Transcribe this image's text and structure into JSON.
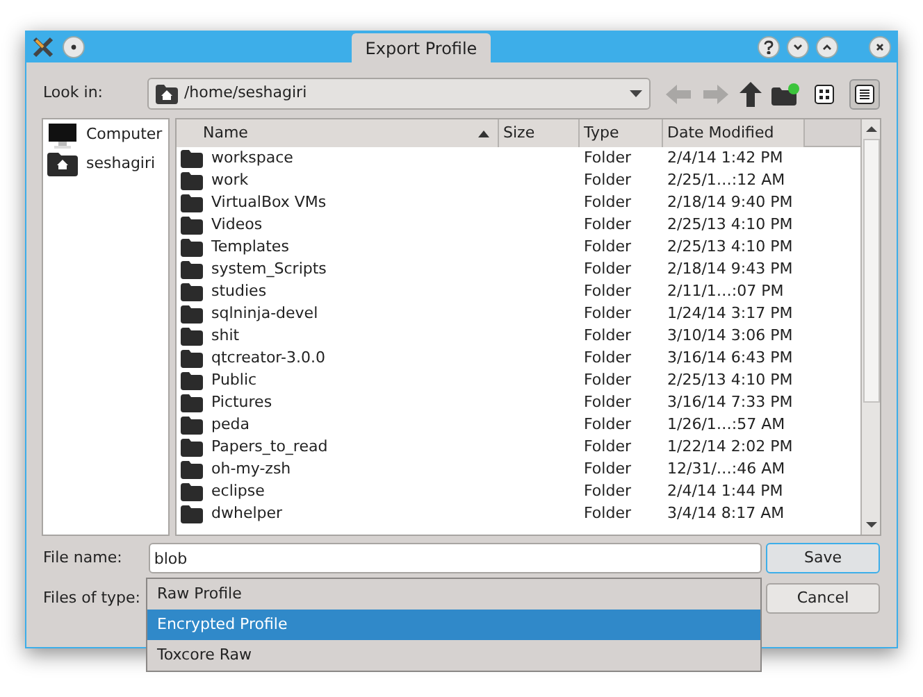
{
  "window": {
    "title": "Export Profile"
  },
  "look_in": {
    "label": "Look in:",
    "path": "/home/seshagiri"
  },
  "sidebar": {
    "items": [
      {
        "label": "Computer",
        "kind": "computer"
      },
      {
        "label": "seshagiri",
        "kind": "home"
      }
    ]
  },
  "table": {
    "columns": [
      {
        "label": "Name",
        "sorted": true
      },
      {
        "label": "Size",
        "sorted": false
      },
      {
        "label": "Type",
        "sorted": false
      },
      {
        "label": "Date Modified",
        "sorted": false
      }
    ],
    "rows": [
      [
        "workspace",
        "",
        "Folder",
        "2/4/14 1:42 PM"
      ],
      [
        "work",
        "",
        "Folder",
        "2/25/1…:12 AM"
      ],
      [
        "VirtualBox VMs",
        "",
        "Folder",
        "2/18/14 9:40 PM"
      ],
      [
        "Videos",
        "",
        "Folder",
        "2/25/13 4:10 PM"
      ],
      [
        "Templates",
        "",
        "Folder",
        "2/25/13 4:10 PM"
      ],
      [
        "system_Scripts",
        "",
        "Folder",
        "2/18/14 9:43 PM"
      ],
      [
        "studies",
        "",
        "Folder",
        "2/11/1…:07 PM"
      ],
      [
        "sqlninja-devel",
        "",
        "Folder",
        "1/24/14 3:17 PM"
      ],
      [
        "shit",
        "",
        "Folder",
        "3/10/14 3:06 PM"
      ],
      [
        "qtcreator-3.0.0",
        "",
        "Folder",
        "3/16/14 6:43 PM"
      ],
      [
        "Public",
        "",
        "Folder",
        "2/25/13 4:10 PM"
      ],
      [
        "Pictures",
        "",
        "Folder",
        "3/16/14 7:33 PM"
      ],
      [
        "peda",
        "",
        "Folder",
        "1/26/1…:57 AM"
      ],
      [
        "Papers_to_read",
        "",
        "Folder",
        "1/22/14 2:02 PM"
      ],
      [
        "oh-my-zsh",
        "",
        "Folder",
        "12/31/…:46 AM"
      ],
      [
        "eclipse",
        "",
        "Folder",
        "2/4/14 1:44 PM"
      ],
      [
        "dwhelper",
        "",
        "Folder",
        "3/4/14 8:17 AM"
      ]
    ]
  },
  "file_name": {
    "label": "File name:",
    "value": "blob"
  },
  "file_type": {
    "label": "Files of type:",
    "options": [
      {
        "label": "Raw Profile",
        "selected": false
      },
      {
        "label": "Encrypted Profile",
        "selected": true
      },
      {
        "label": "Toxcore Raw",
        "selected": false
      }
    ]
  },
  "buttons": [
    {
      "label": "Save",
      "kind": "default"
    },
    {
      "label": "Cancel",
      "kind": "normal"
    }
  ]
}
